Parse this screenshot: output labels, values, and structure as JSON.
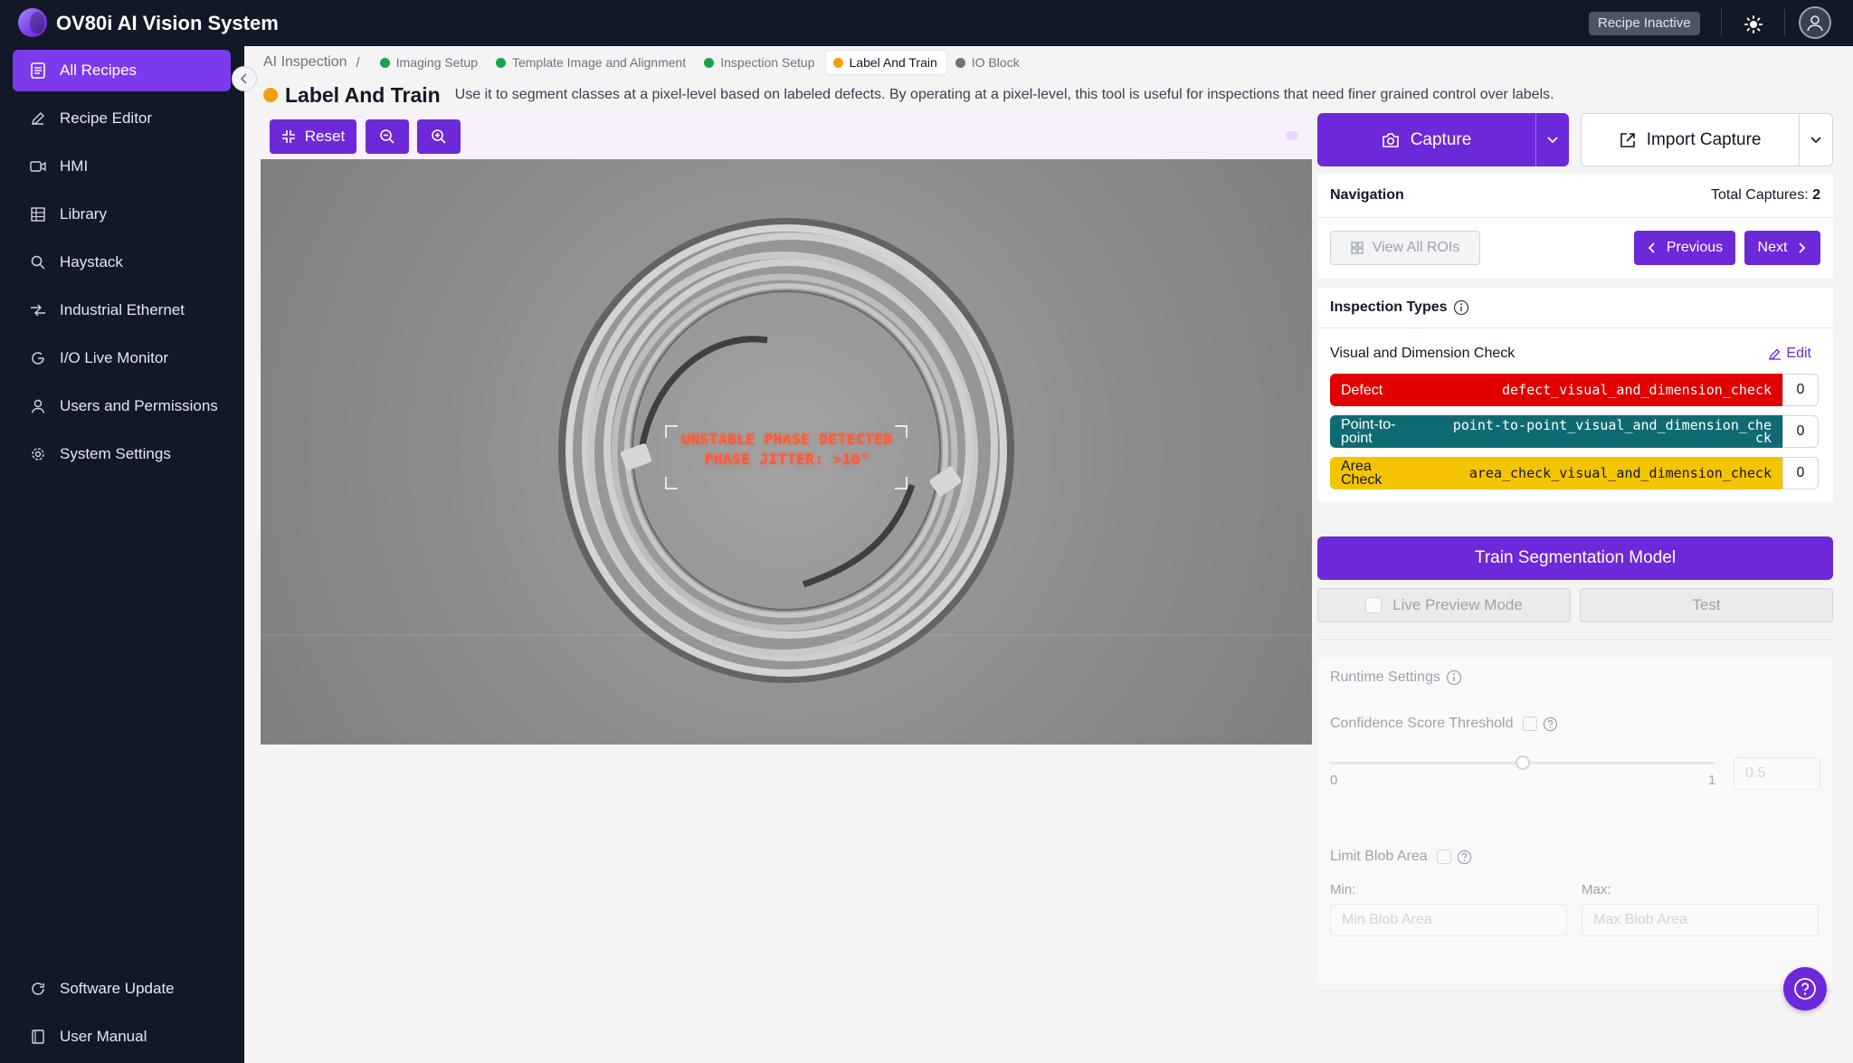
{
  "app": {
    "title": "OV80i AI Vision System",
    "recipe_status": "Recipe Inactive"
  },
  "sidebar": {
    "items": [
      {
        "label": "All Recipes",
        "icon": "recipes-icon",
        "active": true
      },
      {
        "label": "Recipe Editor",
        "icon": "pencil-icon"
      },
      {
        "label": "HMI",
        "icon": "video-icon"
      },
      {
        "label": "Library",
        "icon": "grid-icon"
      },
      {
        "label": "Haystack",
        "icon": "search-icon"
      },
      {
        "label": "Industrial Ethernet",
        "icon": "network-icon"
      },
      {
        "label": "I/O Live Monitor",
        "icon": "monitor-icon"
      },
      {
        "label": "Users and Permissions",
        "icon": "user-icon"
      },
      {
        "label": "System Settings",
        "icon": "gear-icon"
      }
    ],
    "footer": [
      {
        "label": "Software Update",
        "icon": "refresh-icon"
      },
      {
        "label": "User Manual",
        "icon": "book-icon"
      }
    ]
  },
  "breadcrumb": {
    "root": "AI Inspection",
    "separator": "/",
    "steps": [
      {
        "label": "Imaging Setup",
        "color": "#16a34a"
      },
      {
        "label": "Template Image and Alignment",
        "color": "#16a34a"
      },
      {
        "label": "Inspection Setup",
        "color": "#16a34a"
      },
      {
        "label": "Label And Train",
        "color": "#f59e0b",
        "current": true
      },
      {
        "label": "IO Block",
        "color": "#6b7280"
      }
    ]
  },
  "header": {
    "title": "Label And Train",
    "description": "Use it to segment classes at a pixel-level based on labeled defects. By operating at a pixel-level, this tool is useful for inspections that need finer grained control over labels."
  },
  "toolbar": {
    "reset_label": "Reset",
    "zoom_out_icon": "zoom-out-icon",
    "zoom_in_icon": "zoom-in-icon"
  },
  "image": {
    "overlay_line1": "UNSTABLE PHASE DETECTED",
    "overlay_line2": "PHASE JITTER: >10°"
  },
  "capture": {
    "capture_label": "Capture",
    "import_label": "Import Capture"
  },
  "navigation": {
    "title": "Navigation",
    "total_label": "Total Captures:",
    "total_value": "2",
    "view_all_label": "View All ROIs",
    "previous_label": "Previous",
    "next_label": "Next"
  },
  "inspection_types": {
    "title": "Inspection Types",
    "check_name": "Visual and Dimension Check",
    "edit_label": "Edit",
    "types": [
      {
        "name": "Defect",
        "key": "defect_visual_and_dimension_check",
        "count": "0",
        "color": "#e00000",
        "text_color": "#ffffff"
      },
      {
        "name": "Point-to-point",
        "key": "point-to-point_visual_and_dimension_check",
        "count": "0",
        "color": "#0f6b73",
        "text_color": "#ffffff"
      },
      {
        "name": "Area Check",
        "key": "area_check_visual_and_dimension_check",
        "count": "0",
        "color": "#f5c400",
        "text_color": "#111827"
      }
    ]
  },
  "training": {
    "train_label": "Train Segmentation Model",
    "live_preview_label": "Live Preview Mode",
    "test_label": "Test"
  },
  "runtime": {
    "title": "Runtime Settings",
    "confidence_label": "Confidence Score Threshold",
    "slider_min": "0",
    "slider_max": "1",
    "slider_value": 0.5,
    "confidence_placeholder": "0.5",
    "limit_blob_label": "Limit Blob Area",
    "min_label": "Min:",
    "max_label": "Max:",
    "min_placeholder": "Min Blob Area",
    "max_placeholder": "Max Blob Area"
  }
}
